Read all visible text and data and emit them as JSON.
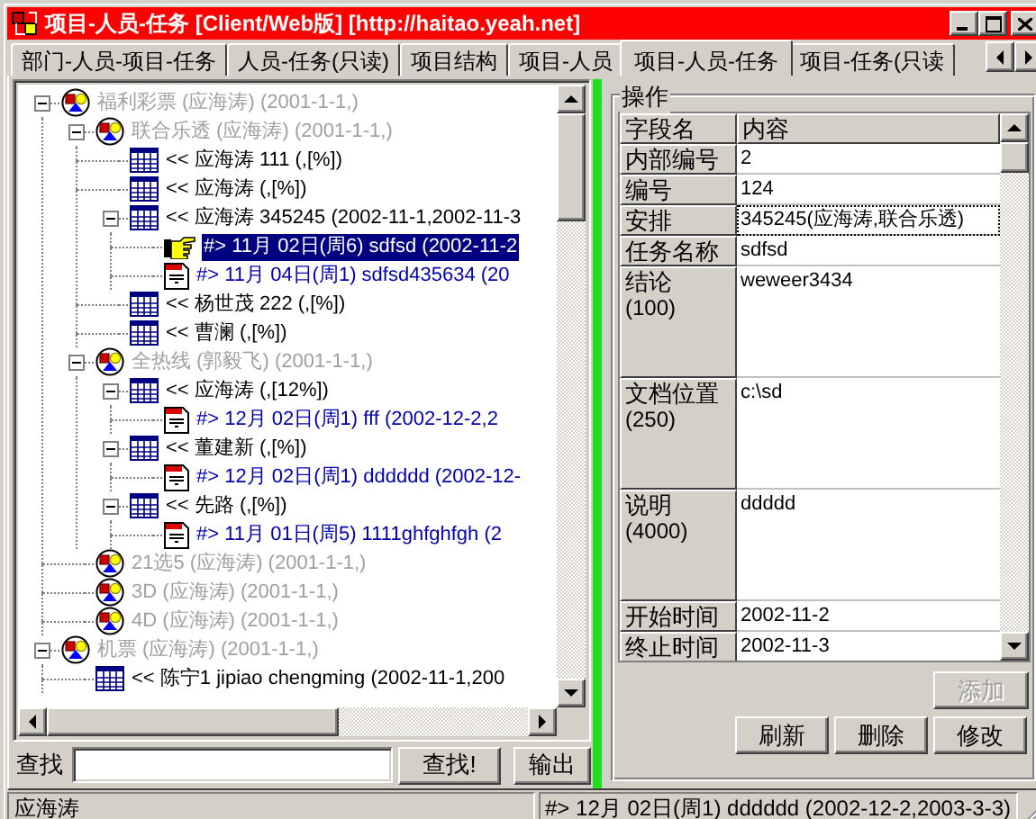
{
  "window": {
    "title": "项目-人员-任务 [Client/Web版] [http://haitao.yeah.net]"
  },
  "tabs": [
    {
      "label": "部门-人员-项目-任务",
      "selected": false
    },
    {
      "label": "人员-任务(只读)",
      "selected": false
    },
    {
      "label": "项目结构",
      "selected": false
    },
    {
      "label": "项目-人员",
      "selected": false
    },
    {
      "label": "项目-人员-任务",
      "selected": true
    },
    {
      "label": "项目-任务(只读",
      "selected": false
    }
  ],
  "tree": [
    {
      "kind": "project",
      "label": "福利彩票 (应海涛) (2001-1-1,)",
      "selected": false,
      "expanded": true,
      "children": [
        {
          "kind": "project",
          "label": "联合乐透 (应海涛) (2001-1-1,)",
          "selected": false,
          "expanded": true,
          "children": [
            {
              "kind": "task",
              "label": "<< 应海涛 111 (,[%])",
              "selected": false
            },
            {
              "kind": "task",
              "label": "<< 应海涛  (,[%])",
              "selected": false
            },
            {
              "kind": "task",
              "label": "<< 应海涛 345245 (2002-11-1,2002-11-3",
              "selected": false,
              "expanded": true,
              "children": [
                {
                  "kind": "item",
                  "label": "#> 11月 02日(周6) sdfsd (2002-11-2",
                  "selected": true
                },
                {
                  "kind": "item",
                  "label": "#> 11月 04日(周1) sdfsd435634 (20",
                  "selected": false
                }
              ]
            },
            {
              "kind": "task",
              "label": "<< 杨世茂 222 (,[%])",
              "selected": false
            },
            {
              "kind": "task",
              "label": "<< 曹澜  (,[%])",
              "selected": false
            }
          ]
        },
        {
          "kind": "project",
          "label": "全热线 (郭毅飞) (2001-1-1,)",
          "selected": false,
          "expanded": true,
          "children": [
            {
              "kind": "task",
              "label": "<< 应海涛  (,[12%])",
              "selected": false,
              "expanded": true,
              "children": [
                {
                  "kind": "item",
                  "label": "#> 12月 02日(周1) fff (2002-12-2,2",
                  "selected": false
                }
              ]
            },
            {
              "kind": "task",
              "label": "<< 董建新  (,[%])",
              "selected": false,
              "expanded": true,
              "children": [
                {
                  "kind": "item",
                  "label": "#> 12月 02日(周1) dddddd (2002-12-",
                  "selected": false
                }
              ]
            },
            {
              "kind": "task",
              "label": "<< 先路  (,[%])",
              "selected": false,
              "expanded": true,
              "children": [
                {
                  "kind": "item",
                  "label": "#> 11月 01日(周5) 1111ghfghfgh (2",
                  "selected": false
                }
              ]
            }
          ]
        },
        {
          "kind": "project",
          "label": "21选5 (应海涛) (2001-1-1,)",
          "selected": false
        },
        {
          "kind": "project",
          "label": "3D (应海涛) (2001-1-1,)",
          "selected": false
        },
        {
          "kind": "project",
          "label": "4D (应海涛) (2001-1-1,)",
          "selected": false
        }
      ]
    },
    {
      "kind": "project",
      "label": "机票 (应海涛) (2001-1-1,)",
      "selected": false,
      "expanded": true,
      "children": [
        {
          "kind": "task",
          "label": "<< 陈宁1 jipiao chengming (2002-11-1,200",
          "selected": false
        }
      ]
    }
  ],
  "find": {
    "label": "查找",
    "button": "查找!",
    "export_button": "输出"
  },
  "panel": {
    "title": "操作",
    "columns": [
      "字段名",
      "内容"
    ],
    "fields": [
      {
        "label": "内部编号",
        "value": "2",
        "focused": false
      },
      {
        "label": "编号",
        "value": "124",
        "focused": false
      },
      {
        "label": "安排",
        "value": "345245(应海涛,联合乐透)",
        "focused": true
      },
      {
        "label": "任务名称",
        "value": "sdfsd",
        "focused": false
      },
      {
        "label": "结论",
        "limit": "(100)",
        "value": "weweer3434",
        "focused": false
      },
      {
        "label": "文档位置",
        "limit": "(250)",
        "value": "c:\\sd",
        "focused": false
      },
      {
        "label": "说明",
        "limit": "(4000)",
        "value": "ddddd",
        "focused": false
      },
      {
        "label": "开始时间",
        "value": "2002-11-2",
        "focused": false
      },
      {
        "label": "终止时间",
        "value": "2002-11-3",
        "focused": false
      }
    ],
    "buttons": [
      {
        "label": "添加",
        "disabled": true
      },
      {
        "label": "刷新",
        "disabled": false
      },
      {
        "label": "删除",
        "disabled": false
      },
      {
        "label": "修改",
        "disabled": false
      }
    ]
  },
  "status_bar": [
    "应海涛",
    "#> 12月 02日(周1) dddddd (2002-12-2,2003-3-3)"
  ]
}
